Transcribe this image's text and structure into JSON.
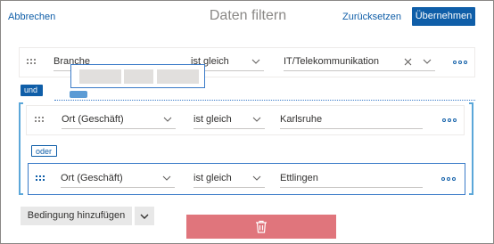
{
  "header": {
    "cancel": "Abbrechen",
    "title": "Daten filtern",
    "reset": "Zurücksetzen",
    "apply": "Übernehmen"
  },
  "conditions": [
    {
      "field": "Branche",
      "operator": "ist gleich",
      "value": "IT/Telekommunikation"
    },
    {
      "field": "Ort (Geschäft)",
      "operator": "ist gleich",
      "value": "Karlsruhe"
    },
    {
      "field": "Ort (Geschäft)",
      "operator": "ist gleich",
      "value": "Ettlingen"
    }
  ],
  "connectors": {
    "and": "und",
    "or": "oder"
  },
  "footer": {
    "add_condition": "Bedingung hinzufügen"
  },
  "colors": {
    "primary": "#0f5ea8",
    "delete": "#e0757c",
    "selected_border": "#3a7bc8"
  },
  "icons": [
    "drag-handle-icon",
    "chevron-down-icon",
    "clear-icon",
    "more-icon",
    "trash-icon"
  ]
}
